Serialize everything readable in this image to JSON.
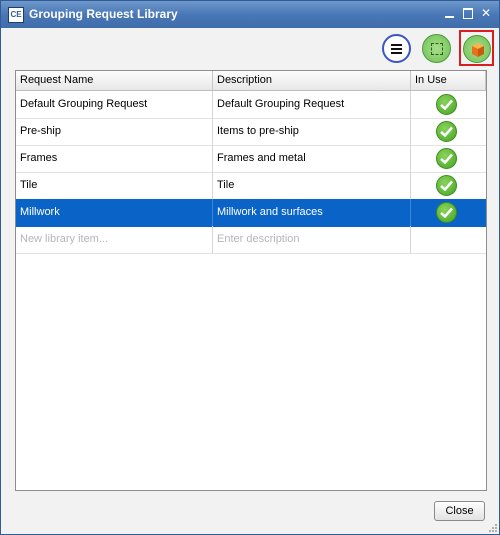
{
  "window": {
    "title": "Grouping Request Library",
    "app_icon_text": "CE"
  },
  "toolbar": {
    "menu_icon": "hamburger-menu-icon",
    "select_icon": "dashed-selection-icon",
    "library_icon": "orange-box-icon",
    "highlight_color": "#d81e1e"
  },
  "table": {
    "columns": [
      "Request Name",
      "Description",
      "In Use"
    ],
    "rows": [
      {
        "name": "Default Grouping Request",
        "description": "Default Grouping Request",
        "in_use": true
      },
      {
        "name": "Pre-ship",
        "description": "Items to pre-ship",
        "in_use": true
      },
      {
        "name": "Frames",
        "description": "Frames and metal",
        "in_use": true
      },
      {
        "name": "Tile",
        "description": "Tile",
        "in_use": true
      },
      {
        "name": "Millwork",
        "description": "Millwork and surfaces",
        "in_use": true,
        "selected": true
      }
    ],
    "new_row": {
      "name_placeholder": "New library item...",
      "description_placeholder": "Enter description"
    },
    "selection_color": "#0a63c6"
  },
  "footer": {
    "close_label": "Close"
  }
}
